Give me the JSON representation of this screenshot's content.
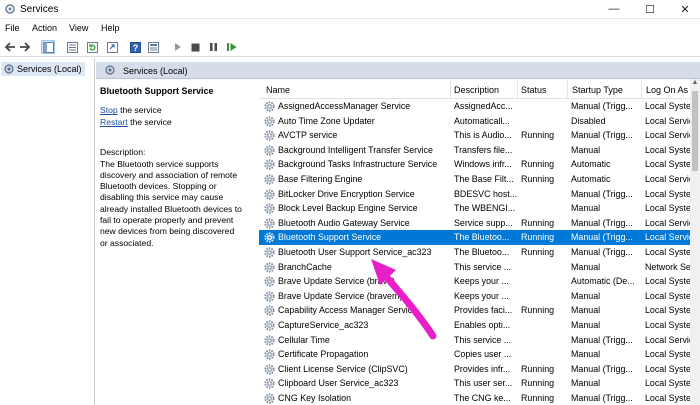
{
  "window": {
    "title": "Services"
  },
  "menu": [
    "File",
    "Action",
    "View",
    "Help"
  ],
  "tree": {
    "label": "Services (Local)"
  },
  "pane": {
    "header": "Services (Local)",
    "selected_name": "Bluetooth Support Service",
    "stop_link": "Stop",
    "stop_rest": " the service",
    "restart_link": "Restart",
    "restart_rest": " the service",
    "desc_heading": "Description:",
    "desc_lines": [
      "The Bluetooth service supports",
      "discovery and association of remote",
      "Bluetooth devices.  Stopping or",
      "disabling this service may cause",
      "already installed Bluetooth devices to",
      "fail to operate properly and prevent",
      "new devices from being discovered",
      "or associated."
    ]
  },
  "table": {
    "columns": {
      "name": "Name",
      "description": "Description",
      "status": "Status",
      "startup": "Startup Type",
      "logon": "Log On As"
    },
    "selected_index": 9,
    "rows": [
      {
        "name": "AssignedAccessManager Service",
        "desc": "AssignedAcc...",
        "status": "",
        "startup": "Manual (Trigg...",
        "logon": "Local Syster"
      },
      {
        "name": "Auto Time Zone Updater",
        "desc": "Automaticall...",
        "status": "",
        "startup": "Disabled",
        "logon": "Local Servic"
      },
      {
        "name": "AVCTP service",
        "desc": "This is Audio...",
        "status": "Running",
        "startup": "Manual (Trigg...",
        "logon": "Local Servic"
      },
      {
        "name": "Background Intelligent Transfer Service",
        "desc": "Transfers file...",
        "status": "",
        "startup": "Manual",
        "logon": "Local Syster"
      },
      {
        "name": "Background Tasks Infrastructure Service",
        "desc": "Windows infr...",
        "status": "Running",
        "startup": "Automatic",
        "logon": "Local Syster"
      },
      {
        "name": "Base Filtering Engine",
        "desc": "The Base Filt...",
        "status": "Running",
        "startup": "Automatic",
        "logon": "Local Servic"
      },
      {
        "name": "BitLocker Drive Encryption Service",
        "desc": "BDESVC host...",
        "status": "",
        "startup": "Manual (Trigg...",
        "logon": "Local Syster"
      },
      {
        "name": "Block Level Backup Engine Service",
        "desc": "The WBENGI...",
        "status": "",
        "startup": "Manual",
        "logon": "Local Syster"
      },
      {
        "name": "Bluetooth Audio Gateway Service",
        "desc": "Service supp...",
        "status": "Running",
        "startup": "Manual (Trigg...",
        "logon": "Local Servic"
      },
      {
        "name": "Bluetooth Support Service",
        "desc": "The Bluetoo...",
        "status": "Running",
        "startup": "Manual (Trigg...",
        "logon": "Local Servic"
      },
      {
        "name": "Bluetooth User Support Service_ac323",
        "desc": "The Bluetoo...",
        "status": "Running",
        "startup": "Manual (Trigg...",
        "logon": "Local Syster"
      },
      {
        "name": "BranchCache",
        "desc": "This service ...",
        "status": "",
        "startup": "Manual",
        "logon": "Network Se"
      },
      {
        "name": "Brave Update Service (brave)",
        "desc": "Keeps your ...",
        "status": "",
        "startup": "Automatic (De...",
        "logon": "Local Syster"
      },
      {
        "name": "Brave Update Service (bravem)",
        "desc": "Keeps your ...",
        "status": "",
        "startup": "Manual",
        "logon": "Local Syster"
      },
      {
        "name": "Capability Access Manager Service",
        "desc": "Provides faci...",
        "status": "Running",
        "startup": "Manual",
        "logon": "Local Syster"
      },
      {
        "name": "CaptureService_ac323",
        "desc": "Enables opti...",
        "status": "",
        "startup": "Manual",
        "logon": "Local Syster"
      },
      {
        "name": "Cellular Time",
        "desc": "This service ...",
        "status": "",
        "startup": "Manual (Trigg...",
        "logon": "Local Servic"
      },
      {
        "name": "Certificate Propagation",
        "desc": "Copies user ...",
        "status": "",
        "startup": "Manual",
        "logon": "Local Syster"
      },
      {
        "name": "Client License Service (ClipSVC)",
        "desc": "Provides infr...",
        "status": "Running",
        "startup": "Manual (Trigg...",
        "logon": "Local Syster"
      },
      {
        "name": "Clipboard User Service_ac323",
        "desc": "This user ser...",
        "status": "Running",
        "startup": "Manual",
        "logon": "Local Syster"
      },
      {
        "name": "CNG Key Isolation",
        "desc": "The CNG ke...",
        "status": "Running",
        "startup": "Manual (Trigg...",
        "logon": "Local Syster"
      }
    ]
  },
  "colors": {
    "selection": "#0078d7",
    "annotation_arrow": "#e81ec8",
    "link": "#1a4fa0",
    "header_band": "#d4dde8"
  },
  "icons": {
    "toolbar": [
      "back-arrow-icon",
      "forward-arrow-icon",
      "console-tree-icon",
      "properties-list-icon",
      "refresh-icon",
      "export-icon",
      "help-icon",
      "mmc-view-icon",
      "play-icon",
      "stop-icon",
      "pause-icon",
      "restart-icon"
    ],
    "row": "gear-icon"
  }
}
